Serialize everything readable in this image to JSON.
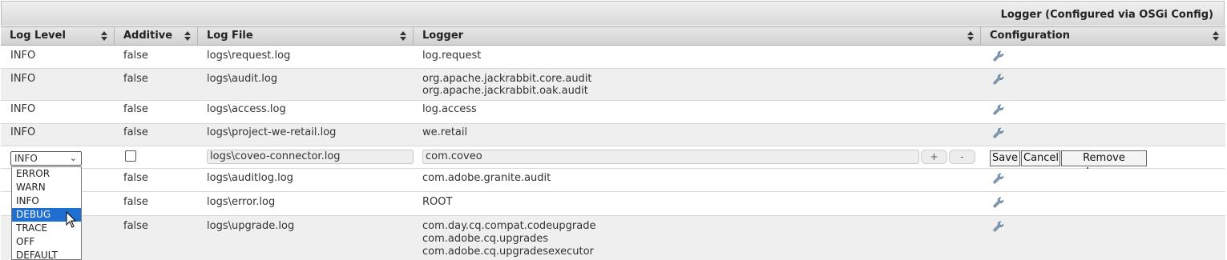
{
  "panel": {
    "title": "Logger (Configured via OSGi Config)"
  },
  "columns": [
    "Log Level",
    "Additive",
    "Log File",
    "Logger",
    "Configuration"
  ],
  "rows": [
    {
      "level": "INFO",
      "additive": "false",
      "file": "logs\\request.log",
      "loggers": [
        "log.request"
      ]
    },
    {
      "level": "INFO",
      "additive": "false",
      "file": "logs\\audit.log",
      "loggers": [
        "org.apache.jackrabbit.core.audit",
        "org.apache.jackrabbit.oak.audit"
      ]
    },
    {
      "level": "INFO",
      "additive": "false",
      "file": "logs\\access.log",
      "loggers": [
        "log.access"
      ]
    },
    {
      "level": "INFO",
      "additive": "false",
      "file": "logs\\project-we-retail.log",
      "loggers": [
        "we.retail"
      ]
    }
  ],
  "edit_row": {
    "level_value": "INFO",
    "additive_checked": false,
    "file_value": "logs\\coveo-connector.log",
    "logger_value": "com.coveo",
    "plus_label": "+",
    "minus_label": "-",
    "save_label": "Save",
    "cancel_label": "Cancel",
    "remove_label": "Remove Logger"
  },
  "rows_after": [
    {
      "additive": "false",
      "file": "logs\\auditlog.log",
      "loggers": [
        "com.adobe.granite.audit"
      ]
    },
    {
      "additive": "false",
      "file": "logs\\error.log",
      "loggers": [
        "ROOT"
      ]
    },
    {
      "additive": "false",
      "file": "logs\\upgrade.log",
      "loggers": [
        "com.day.cq.compat.codeupgrade",
        "com.adobe.cq.upgrades",
        "com.adobe.cq.upgradesexecutor"
      ]
    }
  ],
  "level_options": [
    "ERROR",
    "WARN",
    "INFO",
    "DEBUG",
    "TRACE",
    "OFF",
    "DEFAULT"
  ],
  "level_options_selected": "DEBUG",
  "icons": {
    "sort": "sort-icon",
    "config": "wrench-icon",
    "chevron": "chevron-down-icon"
  },
  "colors": {
    "highlight": "#1e6fd0",
    "header_bg": "#dcdcdc"
  }
}
